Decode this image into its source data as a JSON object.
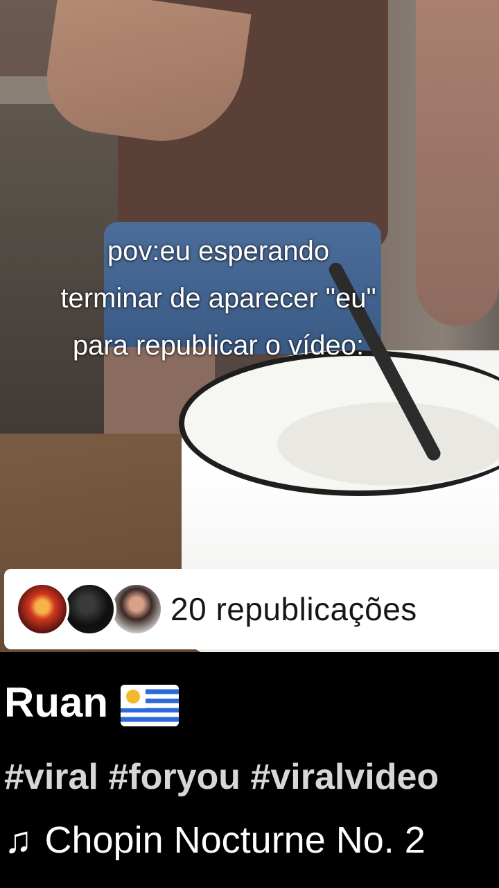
{
  "overlay": {
    "caption_lines": [
      "pov:eu esperando",
      "terminar de aparecer \"eu\"",
      "para republicar o vídeo:"
    ]
  },
  "reposts": {
    "avatars": [
      "avatar-1",
      "avatar-2",
      "avatar-3"
    ],
    "label": "20 republicações"
  },
  "post": {
    "username": "Ruan",
    "flag_icon": "uruguay-flag-icon",
    "hashtags": "#viral #foryou #viralvideo",
    "music_icon": "music-note-icon",
    "music_symbol": "♫",
    "music_title": "Chopin Nocturne No. 2"
  }
}
